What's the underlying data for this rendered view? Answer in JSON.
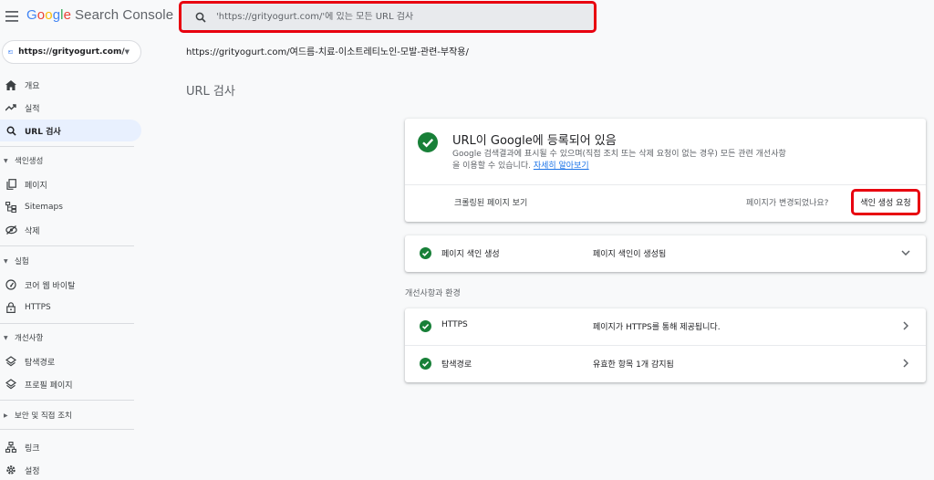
{
  "header": {
    "brand_google": [
      "G",
      "o",
      "o",
      "g",
      "l",
      "e"
    ],
    "brand_rest": "Search Console",
    "search_placeholder": "'https://grityogurt.com/'에 있는 모든 URL 검사"
  },
  "sidebar": {
    "property": "https://grityogurt.com/",
    "items": [
      {
        "label": "개요",
        "icon": "home-icon"
      },
      {
        "label": "실적",
        "icon": "trending-icon"
      },
      {
        "label": "URL 검사",
        "icon": "search-icon",
        "active": true
      }
    ],
    "sections": [
      {
        "label": "색인생성",
        "items": [
          {
            "label": "페이지",
            "icon": "pages-icon"
          },
          {
            "label": "Sitemaps",
            "icon": "sitemap-icon"
          },
          {
            "label": "삭제",
            "icon": "hide-icon"
          }
        ]
      },
      {
        "label": "실험",
        "items": [
          {
            "label": "코어 웹 바이탈",
            "icon": "gauge-icon"
          },
          {
            "label": "HTTPS",
            "icon": "lock-icon"
          }
        ]
      },
      {
        "label": "개선사항",
        "items": [
          {
            "label": "탐색경로",
            "icon": "layers-icon"
          },
          {
            "label": "프로필 페이지",
            "icon": "layers-icon"
          }
        ]
      },
      {
        "label": "보안 및 직접 조치",
        "collapsed": true
      }
    ],
    "bottom_items": [
      {
        "label": "링크",
        "icon": "links-icon"
      },
      {
        "label": "설정",
        "icon": "settings-icon"
      }
    ]
  },
  "main": {
    "breadcrumb": "https://grityogurt.com/여드름-치료-이소트레티노인-모발-관련-부작용/",
    "title": "URL 검사",
    "status_card": {
      "title": "URL이 Google에 등록되어 있음",
      "desc": "Google 검색결과에 표시될 수 있으며(직접 조치 또는 삭제 요청이 없는 경우) 모든 관련 개선사항을 이용할 수 있습니다. ",
      "learn_more": "자세히 알아보기",
      "crawled_link": "크롤링된 페이지 보기",
      "changed_question": "페이지가 변경되었나요?",
      "request_button": "색인 생성 요청"
    },
    "index_row": {
      "label": "페이지 색인 생성",
      "value": "페이지 색인이 생성됨"
    },
    "env_heading": "개선사항과 환경",
    "env_rows": [
      {
        "label": "HTTPS",
        "value": "페이지가 HTTPS를 통해 제공됩니다."
      },
      {
        "label": "탐색경로",
        "value": "유효한 항목 1개 감지됨"
      }
    ]
  },
  "colors": {
    "accent": "#1a73e8",
    "success": "#188038",
    "highlight_border": "#e8000f",
    "active_nav": "#e8f0fe"
  }
}
